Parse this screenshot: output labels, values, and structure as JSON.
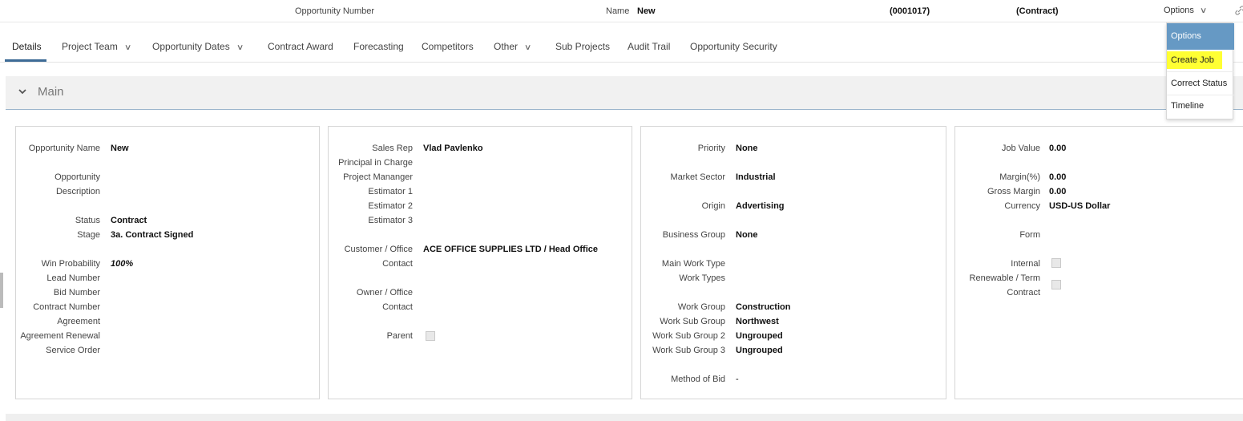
{
  "header": {
    "opportunity_number_label": "Opportunity Number",
    "name_label": "Name",
    "name_value": "New",
    "code": "(0001017)",
    "type": "(Contract)",
    "options_label": "Options"
  },
  "tabs": [
    {
      "label": "Details"
    },
    {
      "label": "Project Team"
    },
    {
      "label": "Opportunity Dates"
    },
    {
      "label": "Contract Award"
    },
    {
      "label": "Forecasting"
    },
    {
      "label": "Competitors"
    },
    {
      "label": "Other"
    },
    {
      "label": "Sub Projects"
    },
    {
      "label": "Audit Trail"
    },
    {
      "label": "Opportunity Security"
    }
  ],
  "section": {
    "title": "Main"
  },
  "card1": {
    "opportunity_name_label": "Opportunity Name",
    "opportunity_name_value": "New",
    "opportunity_label": "Opportunity",
    "description_label": "Description",
    "status_label": "Status",
    "status_value": "Contract",
    "stage_label": "Stage",
    "stage_value": "3a. Contract Signed",
    "win_probability_label": "Win Probability",
    "win_probability_value": "100%",
    "lead_number_label": "Lead Number",
    "bid_number_label": "Bid Number",
    "contract_number_label": "Contract Number",
    "agreement_label": "Agreement",
    "agreement_renewal_label": "Agreement Renewal",
    "service_order_label": "Service Order"
  },
  "card2": {
    "sales_rep_label": "Sales Rep",
    "sales_rep_value": "Vlad Pavlenko",
    "principal_label": "Principal in Charge",
    "project_manager_label": "Project Mananger",
    "estimator1_label": "Estimator 1",
    "estimator2_label": "Estimator 2",
    "estimator3_label": "Estimator 3",
    "customer_office_label": "Customer / Office",
    "customer_office_value": "ACE OFFICE SUPPLIES LTD / Head Office",
    "contact_label": "Contact",
    "owner_office_label": "Owner / Office",
    "owner_contact_label": "Contact",
    "parent_label": "Parent"
  },
  "card3": {
    "priority_label": "Priority",
    "priority_value": "None",
    "market_sector_label": "Market Sector",
    "market_sector_value": "Industrial",
    "origin_label": "Origin",
    "origin_value": "Advertising",
    "business_group_label": "Business Group",
    "business_group_value": "None",
    "main_work_type_label": "Main Work Type",
    "work_types_label": "Work Types",
    "work_group_label": "Work Group",
    "work_group_value": "Construction",
    "work_sub_group_label": "Work Sub Group",
    "work_sub_group_value": "Northwest",
    "work_sub_group2_label": "Work Sub Group 2",
    "work_sub_group2_value": "Ungrouped",
    "work_sub_group3_label": "Work Sub Group 3",
    "work_sub_group3_value": "Ungrouped",
    "method_of_bid_label": "Method of Bid",
    "method_of_bid_value": "-"
  },
  "card4": {
    "job_value_label": "Job Value",
    "job_value_value": "0.00",
    "margin_label": "Margin(%)",
    "margin_value": "0.00",
    "gross_margin_label": "Gross Margin",
    "gross_margin_value": "0.00",
    "currency_label": "Currency",
    "currency_value": "USD-US Dollar",
    "form_label": "Form",
    "internal_label": "Internal",
    "renewable_label": "Renewable / Term",
    "contract_label": "Contract"
  },
  "menu": {
    "header": "Options",
    "items": [
      "Create Job",
      "Correct Status",
      "Timeline"
    ]
  },
  "colors": {
    "accent": "#3d6b96",
    "menu_header": "#6699c4",
    "highlight": "#ffff33"
  }
}
